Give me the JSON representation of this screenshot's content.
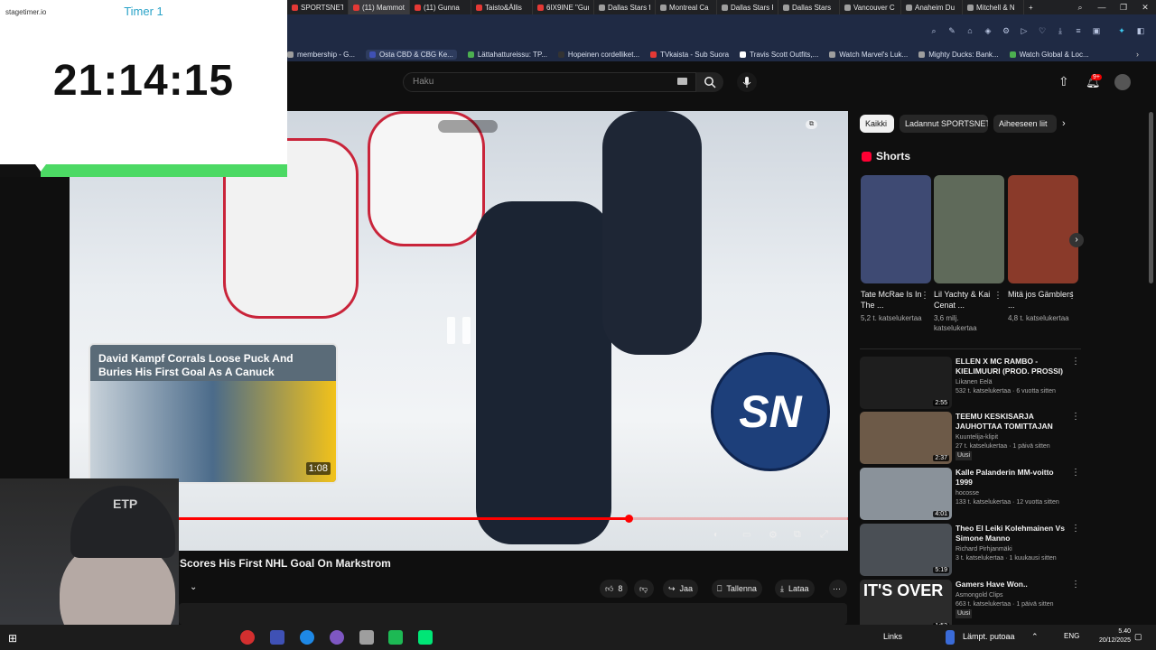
{
  "timer": {
    "brand": "stagetimer.io",
    "name": "Timer 1",
    "time": "21:14:15",
    "progress": 0.86
  },
  "browser": {
    "tabs": [
      {
        "title": "SPORTSNET",
        "color": "#e53935"
      },
      {
        "title": "(11) Mammoth's...",
        "color": "#e53935",
        "active": true
      },
      {
        "title": "(11) Gunna",
        "color": "#e53935"
      },
      {
        "title": "Taisto&Ällis",
        "color": "#e53935"
      },
      {
        "title": "6IX9INE \"Gum",
        "color": "#e53935"
      },
      {
        "title": "Dallas Stars f",
        "color": "#9e9e9e"
      },
      {
        "title": "Montreal Ca",
        "color": "#9e9e9e"
      },
      {
        "title": "Dallas Stars F",
        "color": "#9e9e9e"
      },
      {
        "title": "Dallas Stars",
        "color": "#9e9e9e"
      },
      {
        "title": "Vancouver C",
        "color": "#9e9e9e"
      },
      {
        "title": "Anaheim Du",
        "color": "#9e9e9e"
      },
      {
        "title": "Mitchell & N",
        "color": "#9e9e9e"
      }
    ],
    "new_tab": "+",
    "bookmarks": [
      {
        "title": "membership - G...",
        "color": "#9e9e9e"
      },
      {
        "title": "Osta CBD & CBG Ke...",
        "color": "#3f51b5",
        "highlight": true
      },
      {
        "title": "Lättahattureissu: TP...",
        "color": "#4caf50"
      },
      {
        "title": "Hopeinen cordelliket...",
        "color": "#333333"
      },
      {
        "title": "TVkaista - Sub Suora",
        "color": "#e53935"
      },
      {
        "title": "Travis Scott Outfits,...",
        "color": "#ffffff"
      },
      {
        "title": "Watch Marvel's Luk...",
        "color": "#9e9e9e"
      },
      {
        "title": "Mighty Ducks: Bank...",
        "color": "#9e9e9e"
      },
      {
        "title": "Watch Global & Loc...",
        "color": "#4caf50"
      }
    ]
  },
  "youtube": {
    "search_placeholder": "Haku",
    "notification_count": "9+",
    "video_title": "Scores His First NHL Goal On Markstrom",
    "player_logo": "SN",
    "preview": {
      "title": "David Kampf Corrals Loose Puck And Buries His First Goal As A Canuck",
      "duration": "1:08"
    },
    "actions": {
      "like_count": "8",
      "share": "Jaa",
      "save": "Tallenna",
      "download": "Lataa"
    },
    "chips": [
      "Kaikki",
      "Ladannut SPORTSNET",
      "Aiheeseen liit"
    ],
    "shorts_label": "Shorts",
    "shorts": [
      {
        "title": "Tate McRae Is In The ...",
        "views": "5,2 t. katselukertaa",
        "color": "#3e4a73"
      },
      {
        "title": "Lil Yachty & Kai Cenat ...",
        "views": "3,6 milj. katselukertaa",
        "color": "#5f6a5a"
      },
      {
        "title": "Mitä jos Gämblers ...",
        "views": "4,8 t. katselukertaa",
        "color": "#8a3a2a"
      }
    ],
    "related": [
      {
        "title": "ELLEN X MC RAMBO - KIELIMUURI (PROD. PROSSI)",
        "channel": "Likanen Eelä",
        "meta": "532 t. katselukertaa · 6 vuotta sitten",
        "duration": "2:55",
        "color": "#1e1e1e"
      },
      {
        "title": "TEEMU KESKISARJA JAUHOTTAA TOMITTAJAN",
        "channel": "Kuuntelija-klipit",
        "meta": "27 t. katselukertaa · 1 päivä sitten",
        "badge": "Uusi",
        "duration": "2:37",
        "color": "#6d5a48"
      },
      {
        "title": "Kalle Palanderin MM-voitto 1999",
        "channel": "hocosse",
        "meta": "133 t. katselukertaa · 12 vuotta sitten",
        "duration": "4:01",
        "color": "#8a929a"
      },
      {
        "title": "Theo El Leiki Kolehmainen Vs Simone Manno",
        "channel": "Richard Pirhjanmäki",
        "meta": "3 t. katselukertaa · 1 kuukausi sitten",
        "duration": "5:19",
        "color": "#4a4f55"
      },
      {
        "title": "Gamers Have Won..",
        "channel": "Asmongold Clips",
        "meta": "663 t. katselukertaa · 1 päivä sitten",
        "badge": "Uusi",
        "duration": "1:53",
        "color": "#2b2b2b",
        "thumb_text": "IT'S OVER"
      }
    ]
  },
  "webcam": {
    "cap_text": "ETP"
  },
  "taskbar": {
    "links_label": "Links",
    "weather": "Lämpt. putoaa",
    "lang": "ENG",
    "time": "5.40",
    "date": "20/12/2025"
  }
}
